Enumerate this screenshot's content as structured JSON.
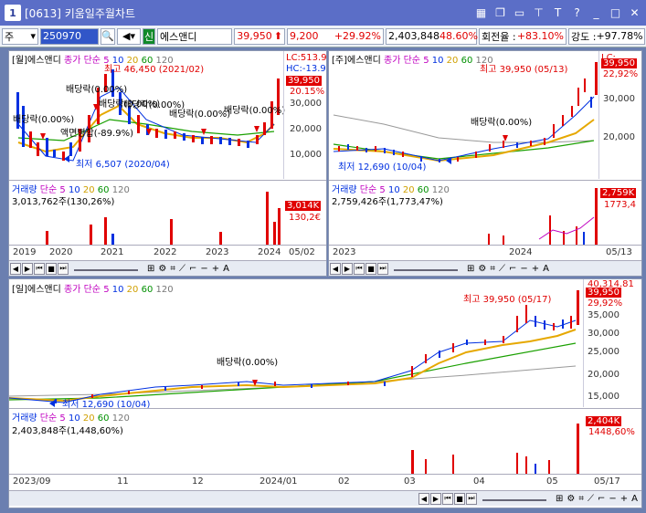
{
  "window": {
    "number": "1",
    "title": "[0613] 키움일주월차트"
  },
  "toolbar": {
    "market": "주",
    "code": "250970",
    "name": "에스앤디",
    "price": "39,950",
    "change": "9,200",
    "change_pct": "+29.92%",
    "volume": "2,403,848",
    "vol_ratio": "48.60%",
    "turnover_label": "회전율 :",
    "turnover": "+83.10%",
    "strength_label": "강도 :",
    "strength": "+97.78%",
    "new_badge": "신"
  },
  "monthly": {
    "title": "[월]에스앤디",
    "ind": [
      "종가",
      "단순",
      "5",
      "10",
      "20",
      "60",
      "120"
    ],
    "high": "최고 46,450 (2021/02)",
    "low": "최저 6,507 (2020/04)",
    "div1": "배당락(0.00%)",
    "div2": "배당락(0.00%)",
    "div3": "배당락(0.00%)",
    "div4": "배당락(0.00%)",
    "div5": "배당락(0.00%)",
    "div6": "배당락(0.00%)",
    "facevalue": "액면병합(-89.9%)",
    "lc": "LC:513.9",
    "hc": "HC:-13.9",
    "price_tag": "39,950",
    "price_pct": "20.15%",
    "yticks": [
      "30,000",
      "20,000",
      "10,000"
    ],
    "xticks": [
      "2019",
      "2020",
      "2021",
      "2022",
      "2023",
      "2024",
      "05/02"
    ],
    "vol_title": "거래량",
    "vol_ind": [
      "단순",
      "5",
      "10",
      "20",
      "60",
      "120"
    ],
    "vol_val": "3,013,762주(130,26%)",
    "vol_tag": "3,014K",
    "vol_tag2": "130,2€"
  },
  "weekly": {
    "title": "[주]에스앤디",
    "ind": [
      "종가",
      "단순",
      "5",
      "10",
      "20",
      "60",
      "120"
    ],
    "high": "최고 39,950 (05/13)",
    "low": "최저 12,690 (10/04)",
    "div": "배당락(0.00%)",
    "lc": "LC:",
    "price_tag": "39,950",
    "price_pct": "22,92%",
    "yticks": [
      "30,000",
      "20,000"
    ],
    "xticks": [
      "2023",
      "2024",
      "05/13"
    ],
    "vol_title": "거래량",
    "vol_ind": [
      "단순",
      "5",
      "10",
      "20",
      "60",
      "120"
    ],
    "vol_val": "2,759,426주(1,773,47%)",
    "vol_tag": "2,759K",
    "vol_tag2": "1773,4"
  },
  "daily": {
    "title": "[일]에스앤디",
    "ind": [
      "종가",
      "단순",
      "5",
      "10",
      "20",
      "60",
      "120"
    ],
    "high": "최고 39,950 (05/17)",
    "low": "최저 12,690 (10/04)",
    "div": "배당락(0.00%)",
    "price_tag": "39,950",
    "price_pct": "29,92%",
    "top_tag": "40,314.81",
    "yticks": [
      "35,000",
      "30,000",
      "25,000",
      "20,000",
      "15,000"
    ],
    "xticks": [
      "2023/09",
      "11",
      "12",
      "2024/01",
      "02",
      "03",
      "04",
      "05",
      "05/17"
    ],
    "vol_title": "거래량",
    "vol_ind": [
      "단순",
      "5",
      "10",
      "20",
      "60",
      "120"
    ],
    "vol_val": "2,403,848주(1,448,60%)",
    "vol_tag": "2,404K",
    "vol_tag2": "1448,60%"
  }
}
